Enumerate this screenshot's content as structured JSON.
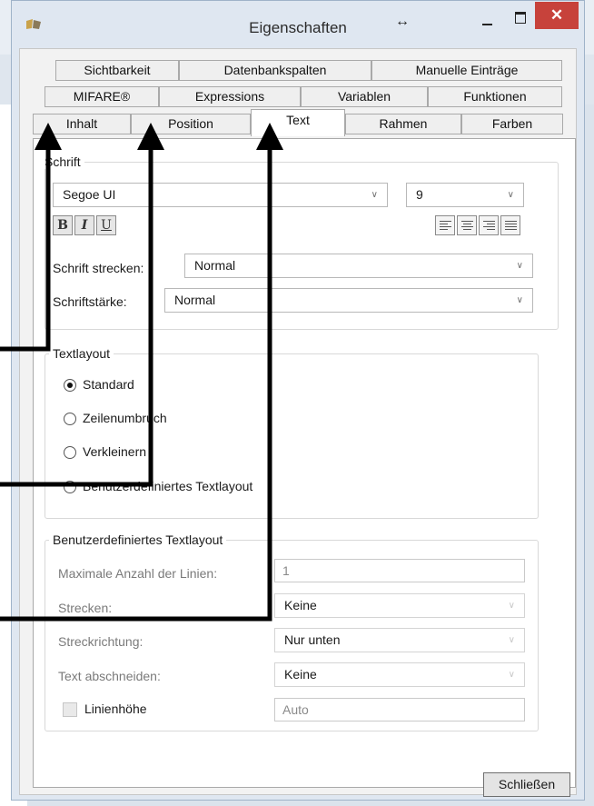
{
  "window": {
    "title": "Eigenschaften",
    "close_glyph": "✕",
    "resize_glyph": "↔"
  },
  "tabs": {
    "row1": [
      "Sichtbarkeit",
      "Datenbankspalten",
      "Manuelle Einträge"
    ],
    "row2": [
      "MIFARE®",
      "Expressions",
      "Variablen",
      "Funktionen"
    ],
    "row3": [
      "Inhalt",
      "Position",
      "Text",
      "Rahmen",
      "Farben"
    ],
    "active": "Text"
  },
  "schrift": {
    "group_label": "Schrift",
    "font_value": "Segoe UI",
    "size_value": "9",
    "bold": "B",
    "italic": "I",
    "underline": "U",
    "stretch_label": "Schrift strecken:",
    "stretch_value": "Normal",
    "weight_label": "Schriftstärke:",
    "weight_value": "Normal"
  },
  "textlayout": {
    "group_label": "Textlayout",
    "options": [
      "Standard",
      "Zeilenumbruch",
      "Verkleinern",
      "Benutzerdefiniertes Textlayout"
    ],
    "selected": "Standard"
  },
  "custom_layout": {
    "group_label": "Benutzerdefiniertes Textlayout",
    "max_lines_label": "Maximale Anzahl der Linien:",
    "max_lines_value": "1",
    "stretch_label": "Strecken:",
    "stretch_value": "Keine",
    "stretch_dir_label": "Streckrichtung:",
    "stretch_dir_value": "Nur unten",
    "clip_label": "Text abschneiden:",
    "clip_value": "Keine",
    "line_height_label": "Linienhöhe",
    "line_height_value": "Auto"
  },
  "footer": {
    "close_label": "Schließen"
  },
  "icons": [
    "app-icon",
    "resize-icon",
    "minimize-icon",
    "maximize-icon",
    "close-icon",
    "chevron-down-icon",
    "align-left-icon",
    "align-center-icon",
    "align-right-icon",
    "align-justify-icon"
  ],
  "colors": {
    "close_red": "#c7423b",
    "window_bg": "#dfe7f1",
    "page_bg": "#ffffff"
  }
}
